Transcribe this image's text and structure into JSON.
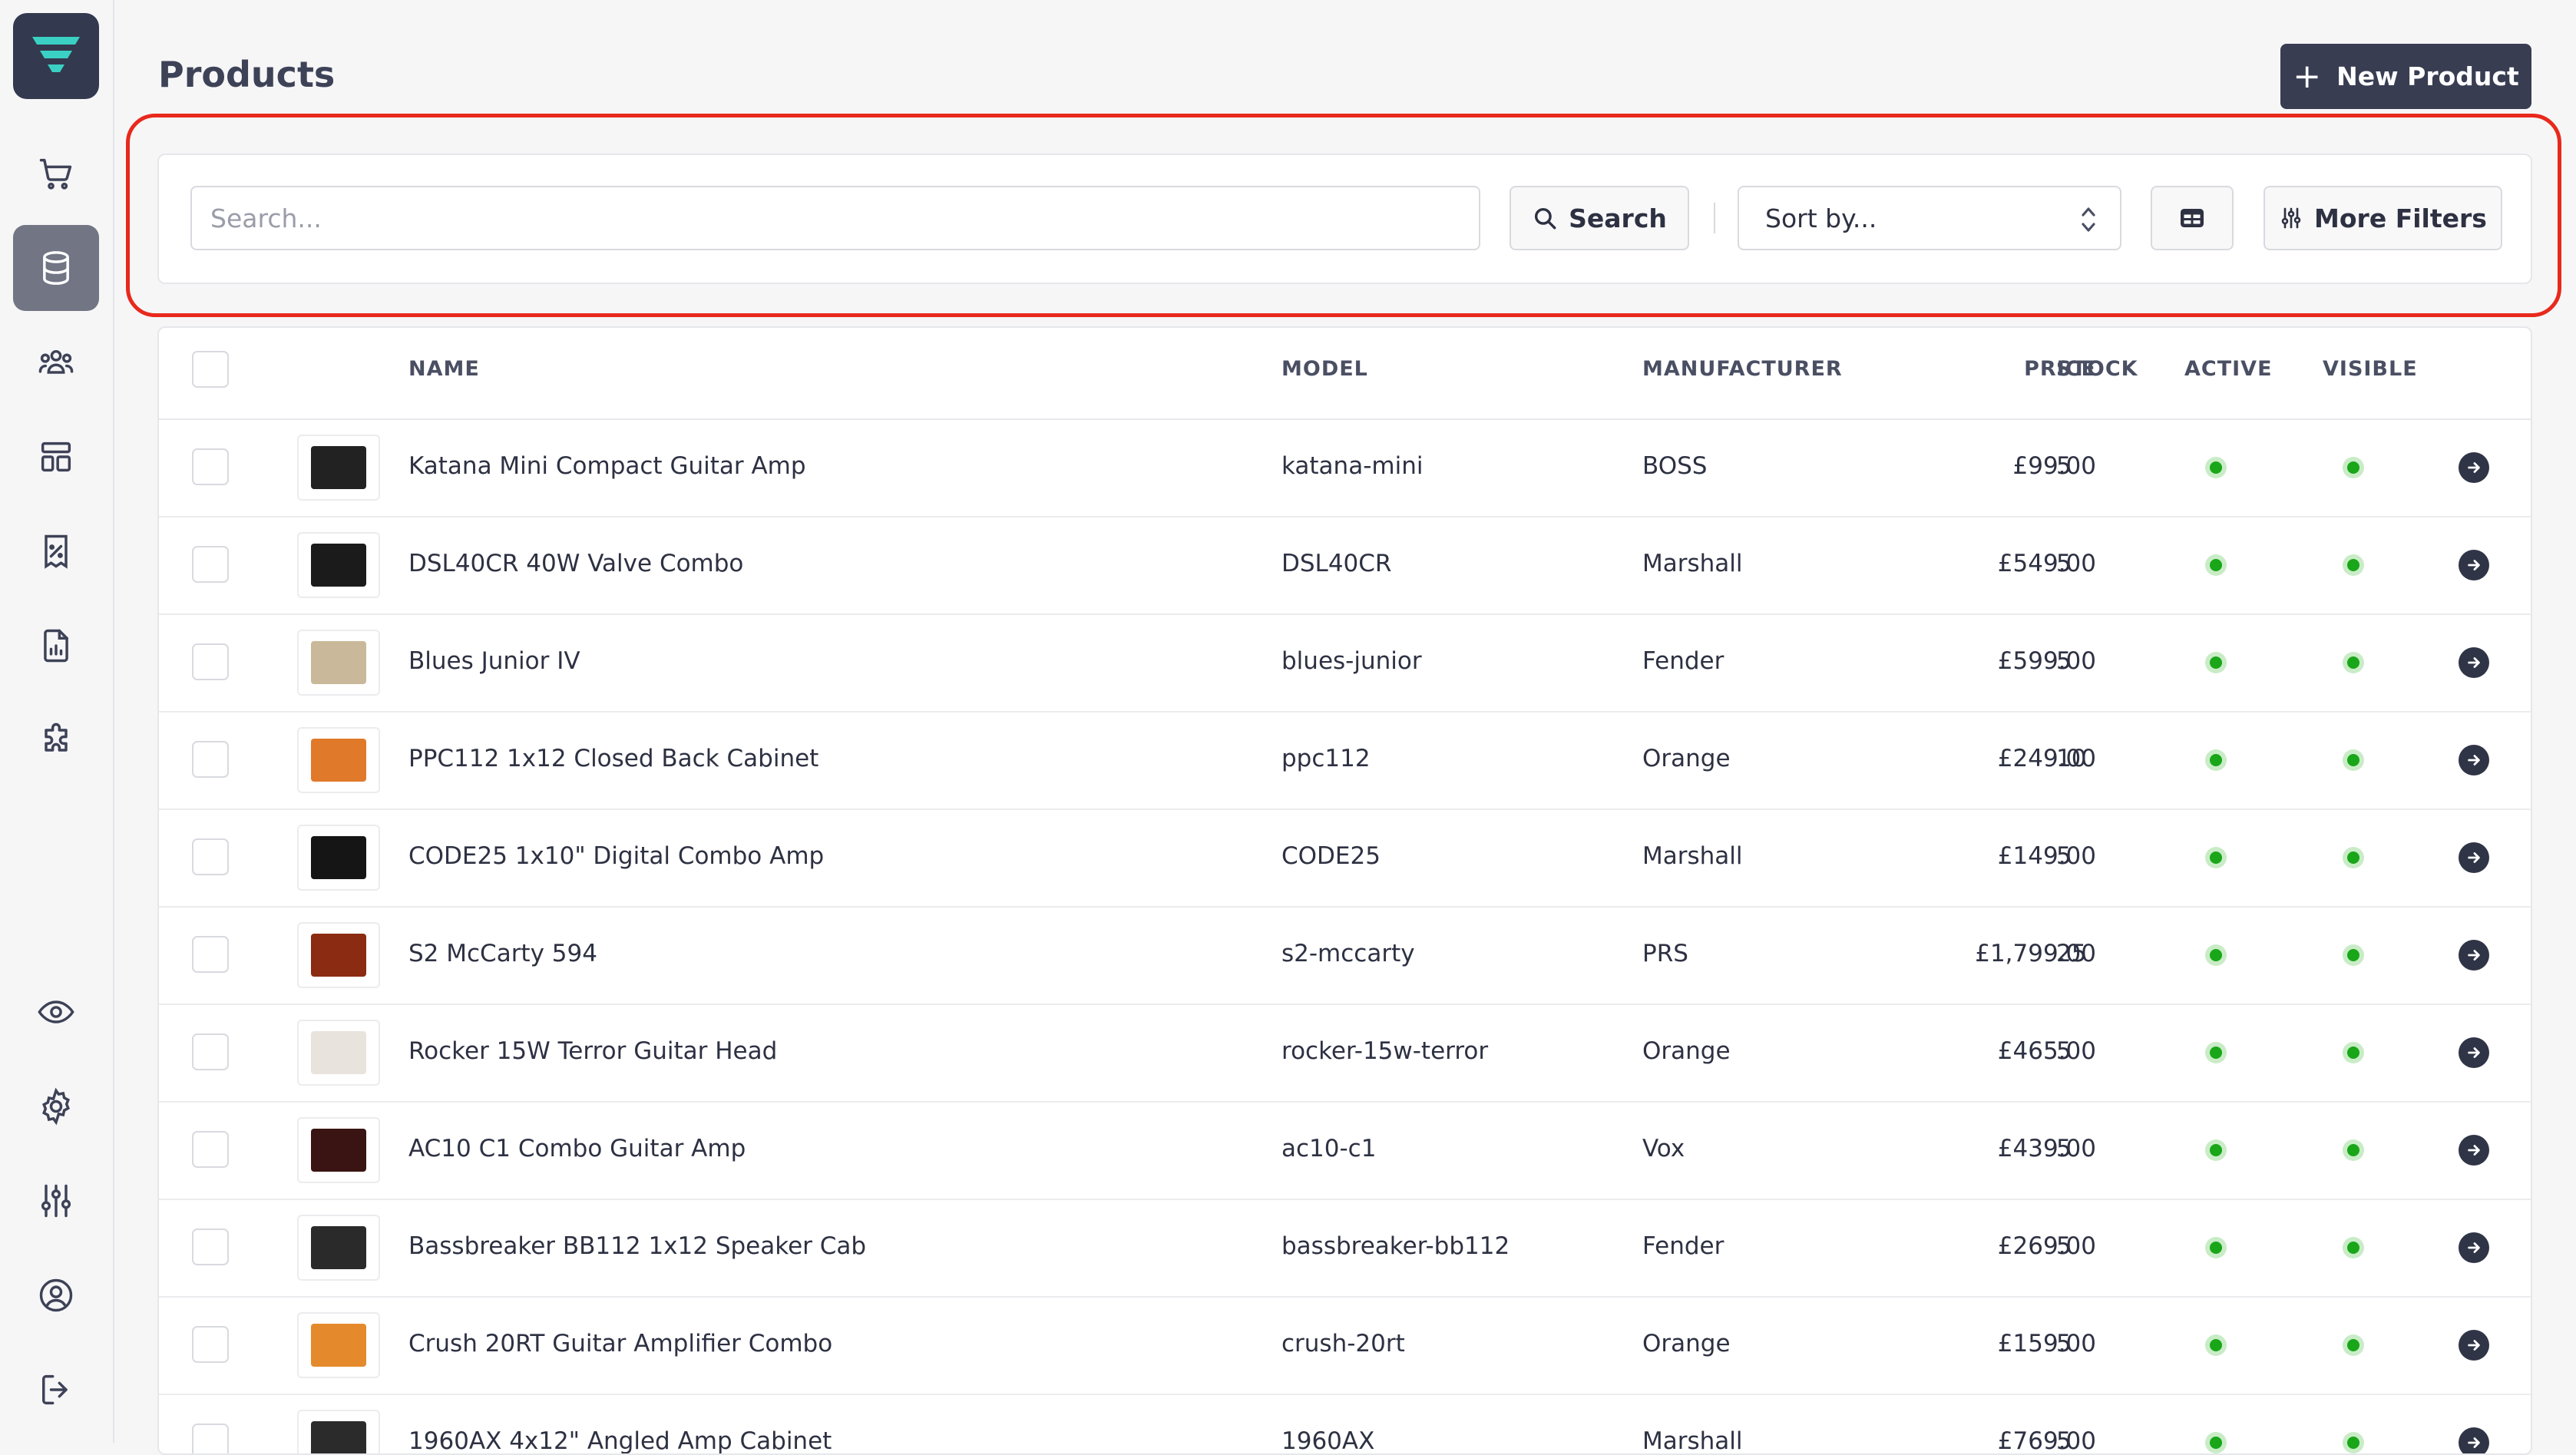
{
  "page": {
    "title": "Products",
    "new_button": "New Product"
  },
  "filters": {
    "search_placeholder": "Search...",
    "search_button": "Search",
    "sort_placeholder": "Sort by...",
    "more_filters": "More Filters"
  },
  "sidebar": {
    "items": [
      {
        "icon": "cart-icon"
      },
      {
        "icon": "database-icon",
        "active": true
      },
      {
        "icon": "users-icon"
      },
      {
        "icon": "layout-icon"
      },
      {
        "icon": "discount-icon"
      },
      {
        "icon": "report-icon"
      },
      {
        "icon": "puzzle-icon"
      },
      {
        "icon": "eye-icon"
      },
      {
        "icon": "gear-icon"
      },
      {
        "icon": "sliders-icon"
      },
      {
        "icon": "user-circle-icon"
      },
      {
        "icon": "logout-icon"
      }
    ]
  },
  "table": {
    "columns": [
      "NAME",
      "MODEL",
      "MANUFACTURER",
      "PRICE",
      "STOCK",
      "ACTIVE",
      "VISIBLE"
    ],
    "rows": [
      {
        "name": "Katana Mini Compact Guitar Amp",
        "model": "katana-mini",
        "manufacturer": "BOSS",
        "price": "£99.00",
        "stock": "5",
        "thumb_color": "#222222"
      },
      {
        "name": "DSL40CR 40W Valve Combo",
        "model": "DSL40CR",
        "manufacturer": "Marshall",
        "price": "£549.00",
        "stock": "5",
        "thumb_color": "#1b1b1b"
      },
      {
        "name": "Blues Junior IV",
        "model": "blues-junior",
        "manufacturer": "Fender",
        "price": "£599.00",
        "stock": "5",
        "thumb_color": "#c9b99a"
      },
      {
        "name": "PPC112 1x12 Closed Back Cabinet",
        "model": "ppc112",
        "manufacturer": "Orange",
        "price": "£249.00",
        "stock": "10",
        "thumb_color": "#e07a2a"
      },
      {
        "name": "CODE25 1x10\" Digital Combo Amp",
        "model": "CODE25",
        "manufacturer": "Marshall",
        "price": "£149.00",
        "stock": "5",
        "thumb_color": "#151515"
      },
      {
        "name": "S2 McCarty 594",
        "model": "s2-mccarty",
        "manufacturer": "PRS",
        "price": "£1,799.00",
        "stock": "25",
        "thumb_color": "#8a2b12"
      },
      {
        "name": "Rocker 15W Terror Guitar Head",
        "model": "rocker-15w-terror",
        "manufacturer": "Orange",
        "price": "£465.00",
        "stock": "5",
        "thumb_color": "#e8e3dc"
      },
      {
        "name": "AC10 C1 Combo Guitar Amp",
        "model": "ac10-c1",
        "manufacturer": "Vox",
        "price": "£439.00",
        "stock": "5",
        "thumb_color": "#3a1412"
      },
      {
        "name": "Bassbreaker BB112 1x12 Speaker Cab",
        "model": "bassbreaker-bb112",
        "manufacturer": "Fender",
        "price": "£269.00",
        "stock": "5",
        "thumb_color": "#2a2a2a"
      },
      {
        "name": "Crush 20RT Guitar Amplifier Combo",
        "model": "crush-20rt",
        "manufacturer": "Orange",
        "price": "£159.00",
        "stock": "5",
        "thumb_color": "#e58a2c"
      },
      {
        "name": "1960AX 4x12\" Angled Amp Cabinet",
        "model": "1960AX",
        "manufacturer": "Marshall",
        "price": "£769.00",
        "stock": "5",
        "thumb_color": "#2b2b2b"
      }
    ]
  },
  "colors": {
    "accent": "#383d52",
    "active_dot": "#19a619",
    "highlight": "#e8291c",
    "logo_mark": "#3ad1c4"
  }
}
